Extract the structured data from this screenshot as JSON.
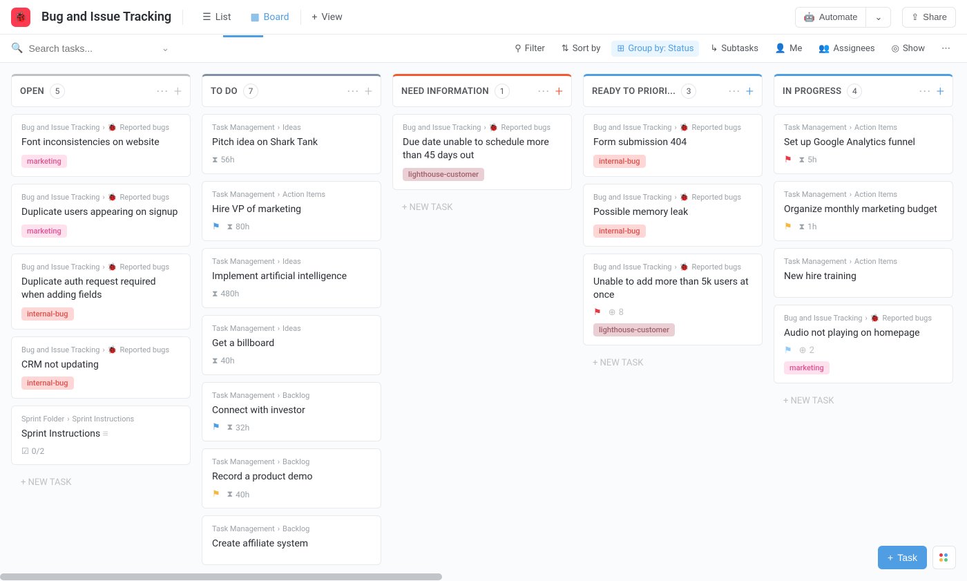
{
  "header": {
    "title": "Bug and Issue Tracking",
    "views": {
      "list": "List",
      "board": "Board",
      "add": "View"
    },
    "automate": "Automate",
    "share": "Share"
  },
  "search": {
    "placeholder": "Search tasks..."
  },
  "toolbar": {
    "filter": "Filter",
    "sort": "Sort by",
    "group": "Group by: Status",
    "subtasks": "Subtasks",
    "me": "Me",
    "assignees": "Assignees",
    "show": "Show"
  },
  "newtask": "+ NEW TASK",
  "fab": "Task",
  "breadcrumbs": {
    "bit": "Bug and Issue Tracking",
    "rb": "Reported bugs",
    "tm": "Task Management",
    "ideas": "Ideas",
    "ai": "Action Items",
    "backlog": "Backlog",
    "sf": "Sprint Folder",
    "si": "Sprint Instructions"
  },
  "tags": {
    "marketing": "marketing",
    "internal": "internal-bug",
    "lighthouse": "lighthouse-customer"
  },
  "cols": {
    "open": {
      "title": "OPEN",
      "count": "5"
    },
    "todo": {
      "title": "TO DO",
      "count": "7"
    },
    "need": {
      "title": "NEED INFORMATION",
      "count": "1"
    },
    "ready": {
      "title": "READY TO PRIORI...",
      "count": "3"
    },
    "progress": {
      "title": "IN PROGRESS",
      "count": "4"
    }
  },
  "cards": {
    "open1": {
      "title": "Font inconsistencies on website"
    },
    "open2": {
      "title": "Duplicate users appearing on signup"
    },
    "open3": {
      "title": "Duplicate auth request required when adding fields"
    },
    "open4": {
      "title": "CRM not updating"
    },
    "open5": {
      "title": "Sprint Instructions",
      "chk": "0/2"
    },
    "todo1": {
      "title": "Pitch idea on Shark Tank",
      "h": "56h"
    },
    "todo2": {
      "title": "Hire VP of marketing",
      "h": "80h"
    },
    "todo3": {
      "title": "Implement artificial intelligence",
      "h": "480h"
    },
    "todo4": {
      "title": "Get a billboard",
      "h": "40h"
    },
    "todo5": {
      "title": "Connect with investor",
      "h": "32h"
    },
    "todo6": {
      "title": "Record a product demo",
      "h": "40h"
    },
    "todo7": {
      "title": "Create affiliate system"
    },
    "need1": {
      "title": "Due date unable to schedule more than 45 days out"
    },
    "ready1": {
      "title": "Form submission 404"
    },
    "ready2": {
      "title": "Possible memory leak"
    },
    "ready3": {
      "title": "Unable to add more than 5k users at once",
      "n": "8"
    },
    "prog1": {
      "title": "Set up Google Analytics funnel",
      "h": "5h"
    },
    "prog2": {
      "title": "Organize monthly marketing budget",
      "h": "1h"
    },
    "prog3": {
      "title": "New hire training"
    },
    "prog4": {
      "title": "Audio not playing on homepage",
      "n": "2"
    }
  }
}
